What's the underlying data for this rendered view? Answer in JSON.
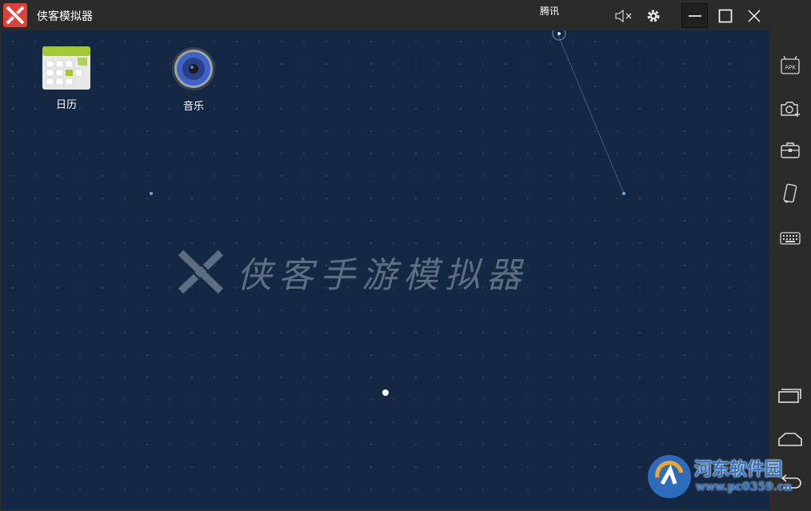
{
  "window": {
    "title": "侠客模拟器",
    "tencent_label": "腾讯"
  },
  "home": {
    "apps": [
      {
        "label": "日历",
        "icon": "calendar-icon"
      },
      {
        "label": "音乐",
        "icon": "music-speaker-icon"
      }
    ],
    "watermark_text": "侠客手游模拟器"
  },
  "sidebar": {
    "items": [
      {
        "name": "install-apk",
        "icon": "apk-icon",
        "badge": "APK"
      },
      {
        "name": "screenshot",
        "icon": "camera-plus-icon"
      },
      {
        "name": "toolbox",
        "icon": "briefcase-icon"
      },
      {
        "name": "rotate",
        "icon": "phone-rotate-icon"
      },
      {
        "name": "keyboard",
        "icon": "keyboard-icon"
      },
      {
        "name": "recent-apps",
        "icon": "recent-apps-icon"
      },
      {
        "name": "home",
        "icon": "home-icon"
      },
      {
        "name": "back",
        "icon": "back-icon"
      }
    ]
  },
  "brand": {
    "name": "河东软件园",
    "url": "www.pc0359.cn"
  },
  "colors": {
    "screen_bg": "#152843",
    "chrome_bg": "#2b2b2b",
    "logo_red": "#e0403a",
    "brand_blue": "#2f73c8"
  }
}
